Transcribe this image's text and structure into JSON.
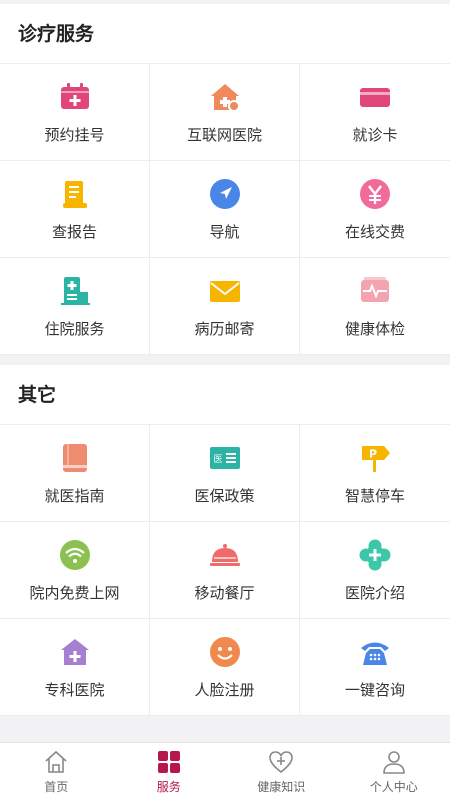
{
  "colors": {
    "accent": "#b8174e",
    "text": "#333333",
    "divider": "#ededed"
  },
  "sections": [
    {
      "title": "诊疗服务",
      "items": [
        {
          "label": "预约挂号",
          "icon": "calendar-plus-icon",
          "color": "#e0457b"
        },
        {
          "label": "互联网医院",
          "icon": "hospital-house-icon",
          "color": "#f08a5d"
        },
        {
          "label": "就诊卡",
          "icon": "card-icon",
          "color": "#e0457b"
        },
        {
          "label": "查报告",
          "icon": "report-icon",
          "color": "#f7b500"
        },
        {
          "label": "导航",
          "icon": "navigation-icon",
          "color": "#4a86e8"
        },
        {
          "label": "在线交费",
          "icon": "yen-coin-icon",
          "color": "#f06a9a"
        },
        {
          "label": "住院服务",
          "icon": "inpatient-building-icon",
          "color": "#2bb3a3"
        },
        {
          "label": "病历邮寄",
          "icon": "mail-envelope-icon",
          "color": "#f7b500"
        },
        {
          "label": "健康体检",
          "icon": "health-check-icon",
          "color": "#f4a3b0"
        }
      ]
    },
    {
      "title": "其它",
      "items": [
        {
          "label": "就医指南",
          "icon": "guide-book-icon",
          "color": "#ef8b6e"
        },
        {
          "label": "医保政策",
          "icon": "insurance-card-icon",
          "color": "#2bb3a3"
        },
        {
          "label": "智慧停车",
          "icon": "parking-sign-icon",
          "color": "#f7b500"
        },
        {
          "label": "院内免费上网",
          "icon": "wifi-icon",
          "color": "#8cc152"
        },
        {
          "label": "移动餐厅",
          "icon": "food-cloche-icon",
          "color": "#f06a6a"
        },
        {
          "label": "医院介绍",
          "icon": "medical-cross-icon",
          "color": "#3cc8a8"
        },
        {
          "label": "专科医院",
          "icon": "specialist-hospital-icon",
          "color": "#a77fd0"
        },
        {
          "label": "人脸注册",
          "icon": "face-icon",
          "color": "#f0894d"
        },
        {
          "label": "一键咨询",
          "icon": "telephone-icon",
          "color": "#4a86e8"
        }
      ]
    }
  ],
  "tabbar": [
    {
      "label": "首页",
      "icon": "home-icon",
      "active": false
    },
    {
      "label": "服务",
      "icon": "grid-icon",
      "active": true
    },
    {
      "label": "健康知识",
      "icon": "heart-plus-icon",
      "active": false
    },
    {
      "label": "个人中心",
      "icon": "user-icon",
      "active": false
    }
  ]
}
